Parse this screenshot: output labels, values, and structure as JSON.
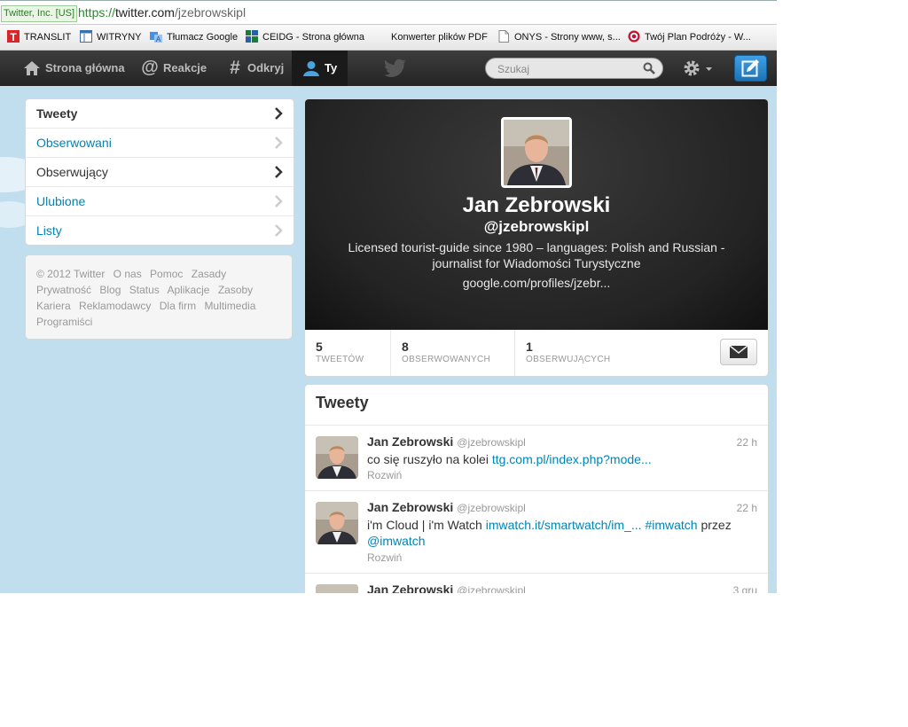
{
  "browser": {
    "cert": "Twitter, Inc. [US]",
    "url_scheme": "https://",
    "url_host": "twitter.com",
    "url_path": "/jzebrowskipl",
    "bookmarks": [
      {
        "label": "TRANSLIT",
        "icon": "translit-icon"
      },
      {
        "label": "WITRYNY",
        "icon": "window-icon"
      },
      {
        "label": "Tłumacz Google",
        "icon": "translate-icon"
      },
      {
        "label": "CEIDG - Strona główna",
        "icon": "ceidg-icon"
      },
      {
        "label": "Konwerter plików PDF",
        "icon": "none"
      },
      {
        "label": "ONYS - Strony www, s...",
        "icon": "page-icon"
      },
      {
        "label": "Twój Plan Podróży - W...",
        "icon": "target-icon"
      }
    ]
  },
  "topbar": {
    "home": "Strona główna",
    "mentions": "Reakcje",
    "discover": "Odkryj",
    "me": "Ty",
    "search_placeholder": "Szukaj"
  },
  "sidebar": {
    "items": [
      {
        "label": "Tweety"
      },
      {
        "label": "Obserwowani"
      },
      {
        "label": "Obserwujący"
      },
      {
        "label": "Ulubione"
      },
      {
        "label": "Listy"
      }
    ],
    "footer_links": [
      "© 2012 Twitter",
      "O nas",
      "Pomoc",
      "Zasady",
      "Prywatność",
      "Blog",
      "Status",
      "Aplikacje",
      "Zasoby",
      "Kariera",
      "Reklamodawcy",
      "Dla firm",
      "Multimedia",
      "Programiści"
    ]
  },
  "profile": {
    "name": "Jan Zebrowski",
    "handle": "@jzebrowskipl",
    "bio": "Licensed tourist-guide since 1980 – languages: Polish and Russian - journalist for Wiadomości Turystyczne",
    "link": "google.com/profiles/jzebr...",
    "stats": [
      {
        "num": "5",
        "label": "TWEETÓW"
      },
      {
        "num": "8",
        "label": "OBSERWOWANYCH"
      },
      {
        "num": "1",
        "label": "OBSERWUJĄCYCH"
      }
    ]
  },
  "tweets": {
    "title": "Tweety",
    "items": [
      {
        "name": "Jan Zebrowski",
        "handle": "@jzebrowskipl",
        "time": "22 h",
        "text_plain": "co się ruszyło na kolei ",
        "link1": "ttg.com.pl/index.php?mode...",
        "more": "Rozwiń"
      },
      {
        "name": "Jan Zebrowski",
        "handle": "@jzebrowskipl",
        "time": "22 h",
        "text_plain": "i'm Cloud | i'm Watch ",
        "link1": "imwatch.it/smartwatch/im_...",
        "hashtag": "#imwatch",
        "via": " przez ",
        "mention": "@imwatch",
        "more": "Rozwiń"
      },
      {
        "name": "Jan Zebrowski",
        "handle": "@jzebrowskipl",
        "time": "3 gru"
      }
    ]
  },
  "colors": {
    "link": "#0084b4",
    "topbar": "#2b2b2b",
    "background": "#c0deed",
    "compose": "#2a87cf"
  }
}
